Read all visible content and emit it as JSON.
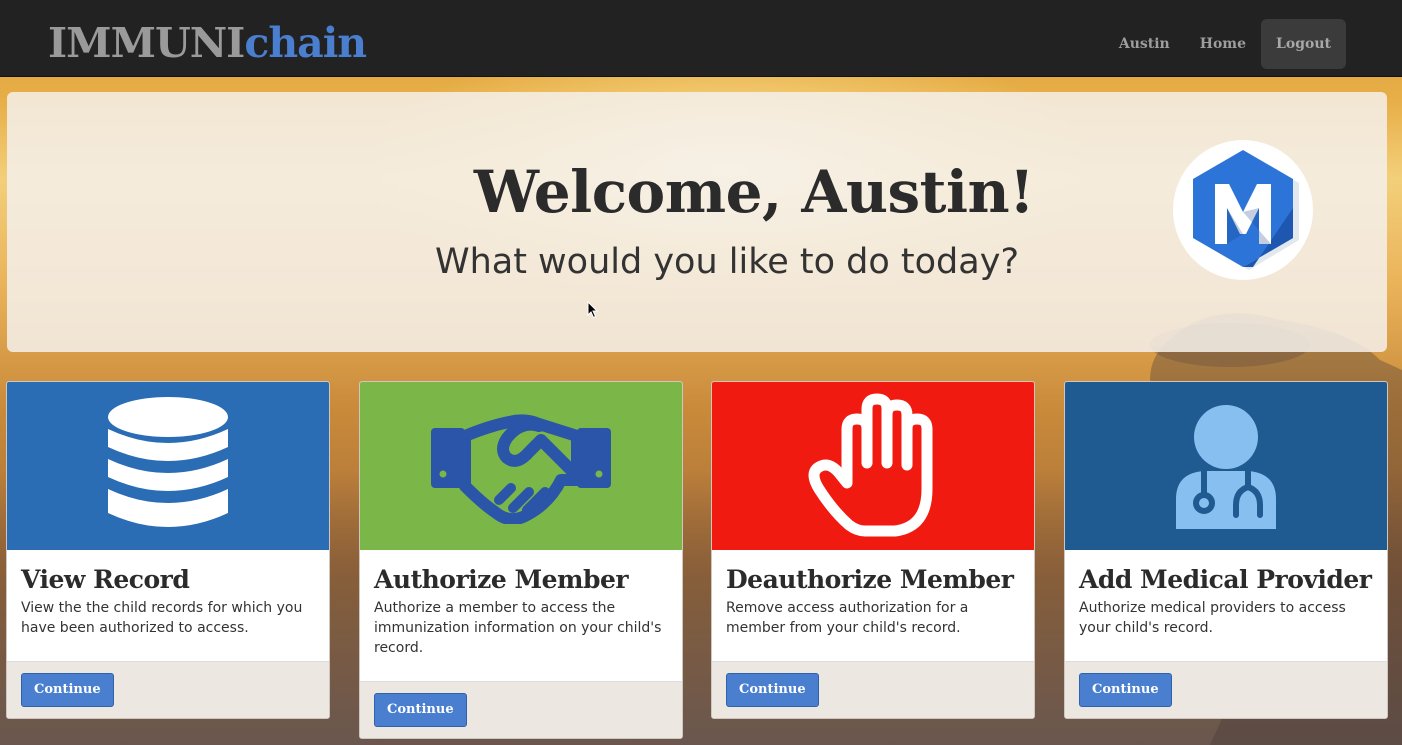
{
  "navbar": {
    "brand_part1": "IMMUNI",
    "brand_part2": "chain",
    "links": [
      "Austin",
      "Home",
      "Logout"
    ]
  },
  "jumbotron": {
    "heading": "Welcome, Austin!",
    "subheading": "What would you like to do today?",
    "logo_icon": "m-hexagon-logo-icon"
  },
  "cards": [
    {
      "title": "View Record",
      "description": "View the the child records for which you have been authorized to access.",
      "button": "Continue",
      "color": "#2a6db5",
      "icon": "database-icon"
    },
    {
      "title": "Authorize Member",
      "description": "Authorize a member to access the immunization information on your child's record.",
      "button": "Continue",
      "color": "#7ab648",
      "icon": "handshake-icon"
    },
    {
      "title": "Deauthorize Member",
      "description": "Remove access authorization for a member from your child's record.",
      "button": "Continue",
      "color": "#f11a10",
      "icon": "hand-stop-icon"
    },
    {
      "title": "Add Medical Provider",
      "description": "Authorize medical providers to access your child's record.",
      "button": "Continue",
      "color": "#1f5a91",
      "icon": "doctor-icon"
    }
  ],
  "colors": {
    "navbar_bg": "#222222",
    "brand_accent": "#4a7fd0",
    "button": "#4a7fd0"
  }
}
